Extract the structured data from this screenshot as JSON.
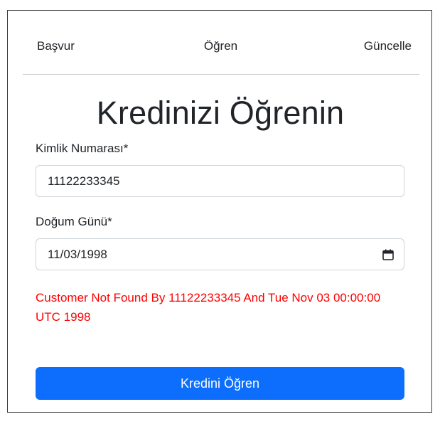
{
  "nav": {
    "items": [
      {
        "label": "Başvur"
      },
      {
        "label": "Öğren"
      },
      {
        "label": "Güncelle"
      }
    ]
  },
  "page": {
    "title": "Kredinizi Öğrenin"
  },
  "form": {
    "id_label": "Kimlik Numarası*",
    "id_value": "11122233345",
    "birth_label": "Doğum Günü*",
    "birth_value": "11/03/1998",
    "error_message": "Customer Not Found By 11122233345 And Tue Nov 03 00:00:00 UTC 1998",
    "submit_label": "Kredini Öğren"
  },
  "icons": {
    "date_picker": "calendar-icon"
  },
  "colors": {
    "primary": "#0d6efd",
    "error": "#ff0000",
    "text": "#212529"
  }
}
